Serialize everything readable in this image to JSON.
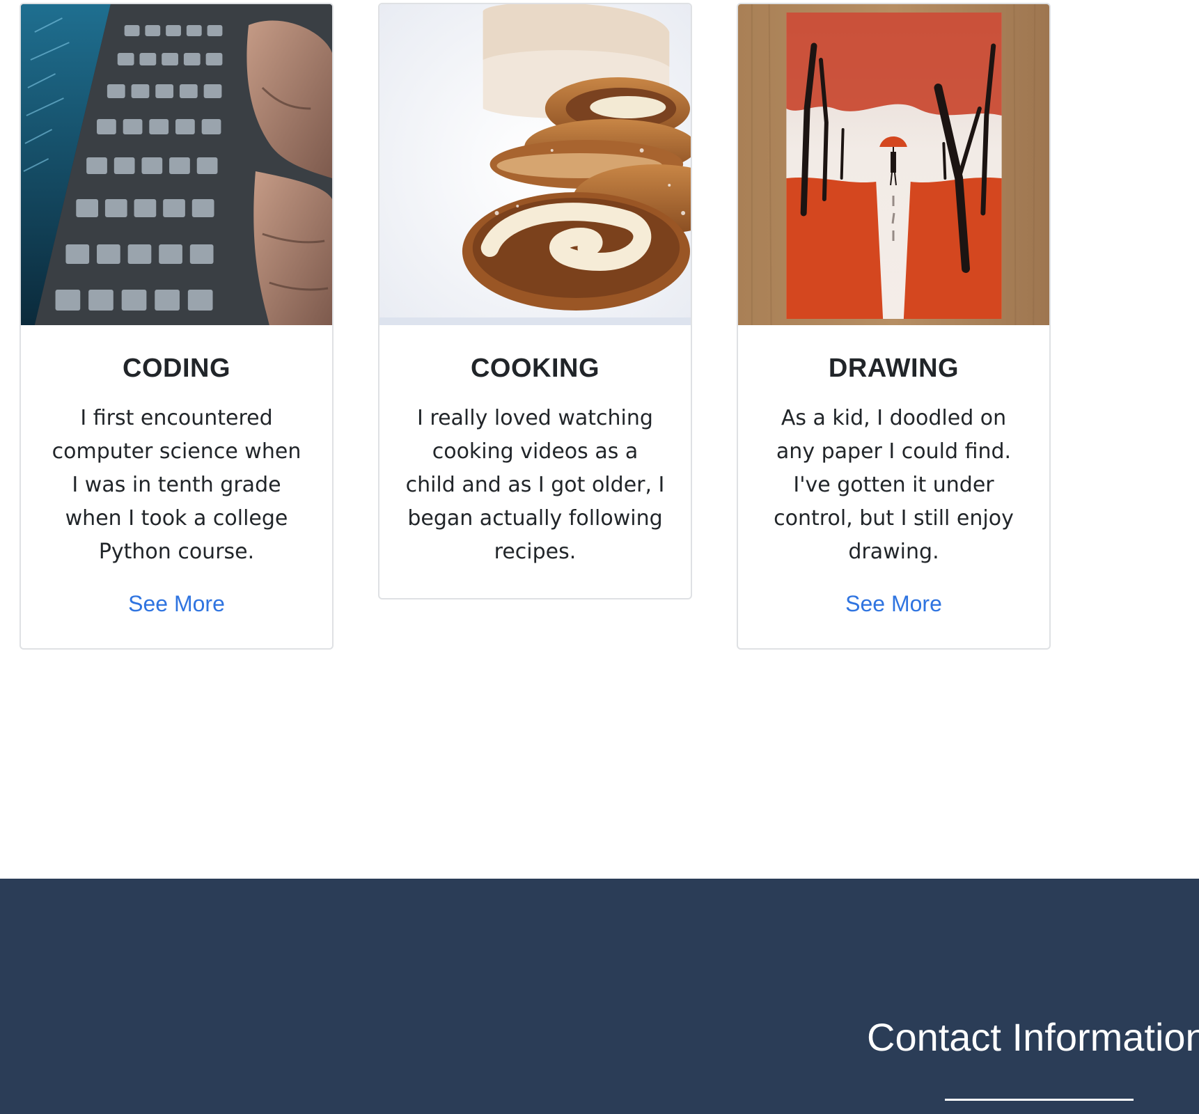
{
  "cards": [
    {
      "image_icon": "laptop-keyboard-photo",
      "title": "CODING",
      "text": "I first encountered computer science when I was in tenth grade when I took a college Python course.",
      "link_label": "See More"
    },
    {
      "image_icon": "swiss-roll-cake-photo",
      "title": "COOKING",
      "text": "I really loved watching cooking videos as a child and as I got older, I began actually following recipes."
    },
    {
      "image_icon": "autumn-painting-photo",
      "title": "DRAWING",
      "text": "As a kid, I doodled on any paper I could find. I've gotten it under control, but I still enjoy drawing.",
      "link_label": "See More"
    }
  ],
  "footer": {
    "title": "Contact Information"
  },
  "colors": {
    "link": "#2f74e0",
    "footer_bg": "#2b3d57",
    "card_border": "#dfe1e4",
    "text": "#212529"
  }
}
